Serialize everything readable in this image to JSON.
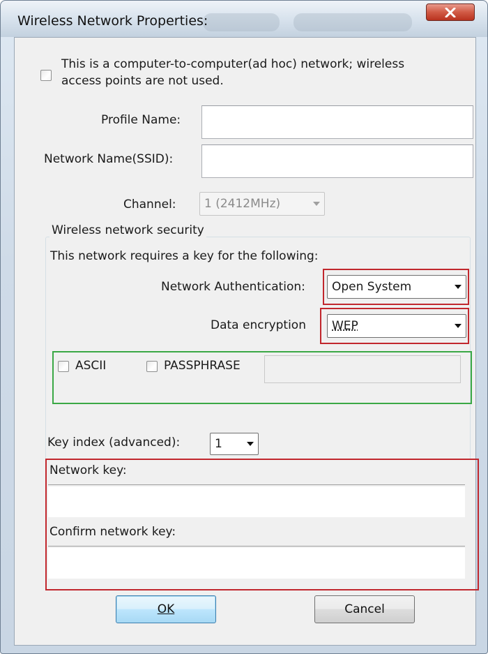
{
  "window": {
    "title": "Wireless Network Properties:",
    "close_glyph": "X"
  },
  "adhoc": {
    "label_line1": "This is a computer-to-computer(ad hoc) network; wireless",
    "label_line2": "access points are not used.",
    "checked": false
  },
  "profile": {
    "label": "Profile Name:",
    "value": ""
  },
  "ssid": {
    "label": "Network Name(SSID):",
    "value": ""
  },
  "channel": {
    "label": "Channel:",
    "value": "1  (2412MHz)",
    "enabled": false
  },
  "security": {
    "group_label": "Wireless network security",
    "intro": "This network requires a key for the following:",
    "auth_label": "Network Authentication:",
    "auth_value": "Open System",
    "enc_label": "Data encryption",
    "enc_value": "WEP",
    "ascii_label": "ASCII",
    "passphrase_label": "PASSPHRASE",
    "passphrase_value": ""
  },
  "key": {
    "index_label": "Key index (advanced):",
    "index_value": "1",
    "network_key_label": "Network key:",
    "network_key_value": "",
    "confirm_label": "Confirm network key:",
    "confirm_value": ""
  },
  "buttons": {
    "ok_label": "OK",
    "cancel_label": "Cancel"
  },
  "colors": {
    "highlight_red": "#c1272d",
    "highlight_green": "#3aa845",
    "close_button": "#d15a45"
  },
  "icons": [
    "close-icon",
    "dropdown-arrow-icon"
  ]
}
